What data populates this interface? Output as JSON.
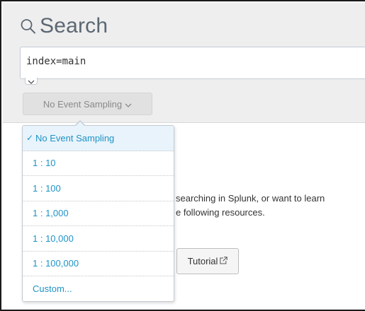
{
  "header": {
    "title": "Search",
    "title_icon": "magnifier-icon"
  },
  "search": {
    "query": "index=main"
  },
  "sampling": {
    "button_label": "No Event Sampling",
    "options": [
      {
        "label": "No Event Sampling",
        "selected": true
      },
      {
        "label": "1 : 10",
        "selected": false
      },
      {
        "label": "1 : 100",
        "selected": false
      },
      {
        "label": "1 : 1,000",
        "selected": false
      },
      {
        "label": "1 : 10,000",
        "selected": false
      },
      {
        "label": "1 : 100,000",
        "selected": false
      },
      {
        "label": "Custom...",
        "selected": false
      }
    ]
  },
  "help": {
    "line1": "searching in Splunk, or want to learn",
    "line2": "e following resources."
  },
  "tutorial": {
    "label": "Tutorial",
    "icon": "external-link-icon"
  },
  "colors": {
    "accent_link": "#1e93c6",
    "header_bg": "#eeeeee",
    "title_text": "#5c6773",
    "selected_bg": "#e8f3fb"
  }
}
